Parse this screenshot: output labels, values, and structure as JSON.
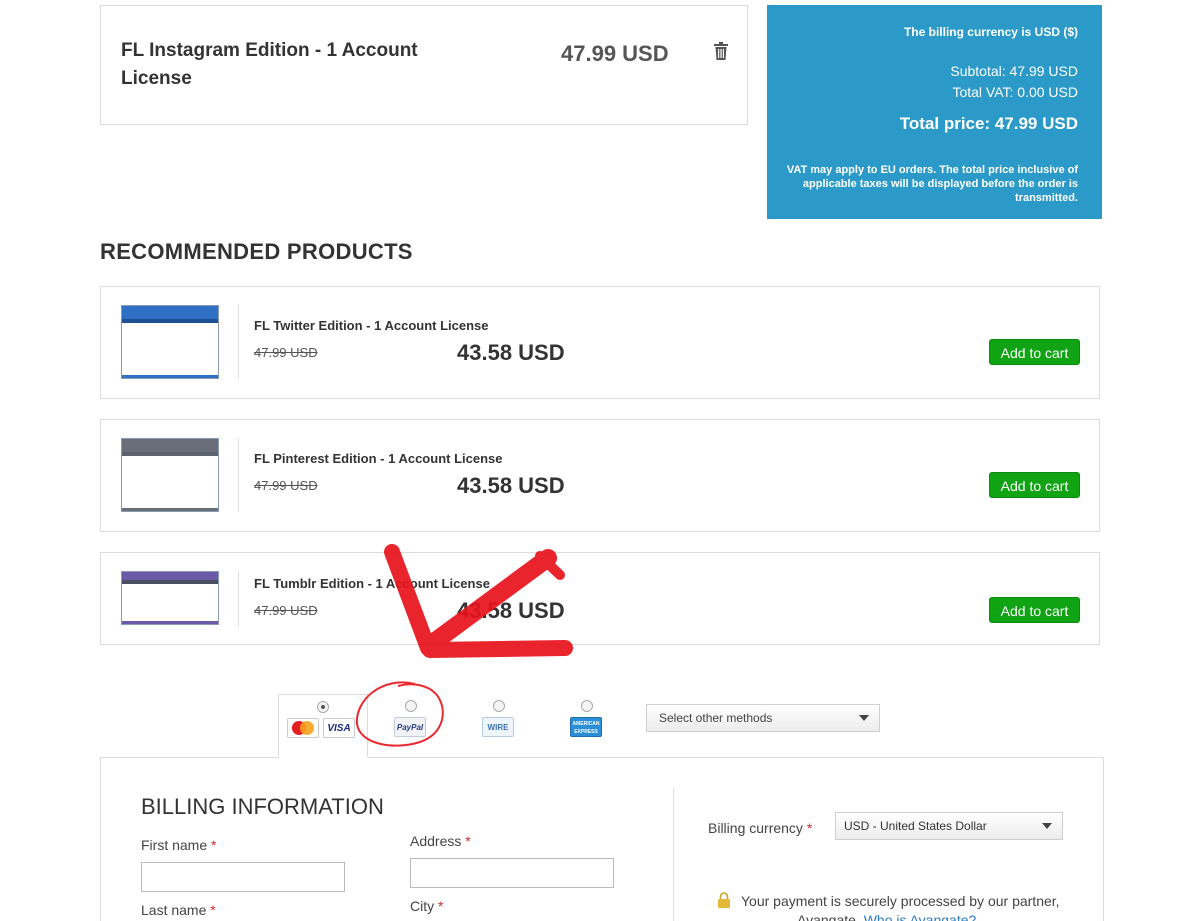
{
  "cart": {
    "item_name": "FL Instagram Edition - 1 Account License",
    "item_price": "47.99 USD"
  },
  "summary": {
    "currency_note": "The billing currency is USD ($)",
    "subtotal": "Subtotal: 47.99 USD",
    "vat": "Total VAT: 0.00 USD",
    "total": "Total price: 47.99 USD",
    "vat_note": "VAT may apply to EU orders. The total price inclusive of applicable taxes will be displayed before the order is transmitted."
  },
  "recommended": {
    "heading": "RECOMMENDED PRODUCTS",
    "products": [
      {
        "name": "FL Twitter Edition - 1 Account License",
        "old_price": "47.99 USD",
        "new_price": "43.58 USD",
        "button": "Add to cart",
        "thumb_color": "#2f6fc4"
      },
      {
        "name": "FL Pinterest Edition - 1 Account License",
        "old_price": "47.99 USD",
        "new_price": "43.58 USD",
        "button": "Add to cart",
        "thumb_color": "#6a6e78"
      },
      {
        "name": "FL Tumblr Edition - 1 Account License",
        "old_price": "47.99 USD",
        "new_price": "43.58 USD",
        "button": "Add to cart",
        "thumb_color": "#6b5aa8"
      }
    ]
  },
  "payment": {
    "methods": [
      {
        "id": "card",
        "logos": [
          "MasterCard",
          "VISA"
        ],
        "selected": true
      },
      {
        "id": "paypal",
        "logos": [
          "PayPal"
        ],
        "selected": false
      },
      {
        "id": "wire",
        "logos": [
          "WIRE"
        ],
        "selected": false
      },
      {
        "id": "amex",
        "logos": [
          "AMERICAN EXPRESS"
        ],
        "selected": false
      }
    ],
    "other_methods": "Select other methods"
  },
  "billing": {
    "title": "BILLING INFORMATION",
    "first_name_label": "First name",
    "last_name_label": "Last name",
    "address_label": "Address",
    "city_label": "City",
    "required_mark": "*",
    "currency_label": "Billing currency",
    "currency_value": "USD - United States Dollar",
    "secure_text": "Your payment is securely processed by our partner,",
    "secure_text_2": "Avangate.",
    "secure_link": "Who is Avangate?"
  },
  "colors": {
    "summary_bg": "#2b9ac8",
    "add_button": "#10a313",
    "annotation": "#e8121b"
  }
}
